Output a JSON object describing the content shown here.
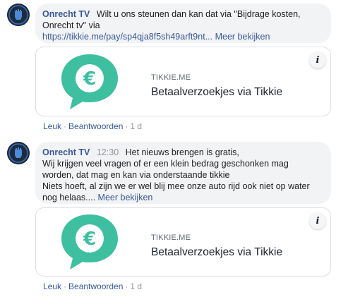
{
  "comments": [
    {
      "author": "Onrecht TV",
      "time": "",
      "line1": "Wilt u ons steunen dan kan dat via \"Bijdrage kosten,",
      "line2": "Onrecht tv\" via",
      "link": "https://tikkie.me/pay/sp4qja8f5sh49arft9nt...",
      "more": "Meer bekijken",
      "card": {
        "domain": "TIKKIE.ME",
        "title": "Betaalverzoekjes via Tikkie",
        "info": "i"
      },
      "actions": {
        "like": "Leuk",
        "reply": "Beantwoorden",
        "age": "1 d"
      }
    },
    {
      "author": "Onrecht TV",
      "time": "12:30",
      "line1": "Het nieuws brengen is gratis,",
      "line2": "Wij krijgen veel vragen of er een klein bedrag geschonken mag",
      "line3": "worden, dat mag en kan via onderstaande tikkie",
      "line4": "Niets hoeft, al zijn we er wel blij mee onze auto rijd ook niet op water",
      "line5": "nog helaas....",
      "more": "Meer bekijken",
      "card": {
        "domain": "TIKKIE.ME",
        "title": "Betaalverzoekjes via Tikkie",
        "info": "i"
      },
      "actions": {
        "like": "Leuk",
        "reply": "Beantwoorden",
        "age": "1 d"
      }
    }
  ],
  "colors": {
    "tikkie_green": "#3dbfa0",
    "link_blue": "#385898",
    "bubble_bg": "#f2f3f5"
  },
  "icons": {
    "avatar": "fist-logo-icon",
    "card": "euro-chat-bubble-icon",
    "info": "info-icon"
  }
}
